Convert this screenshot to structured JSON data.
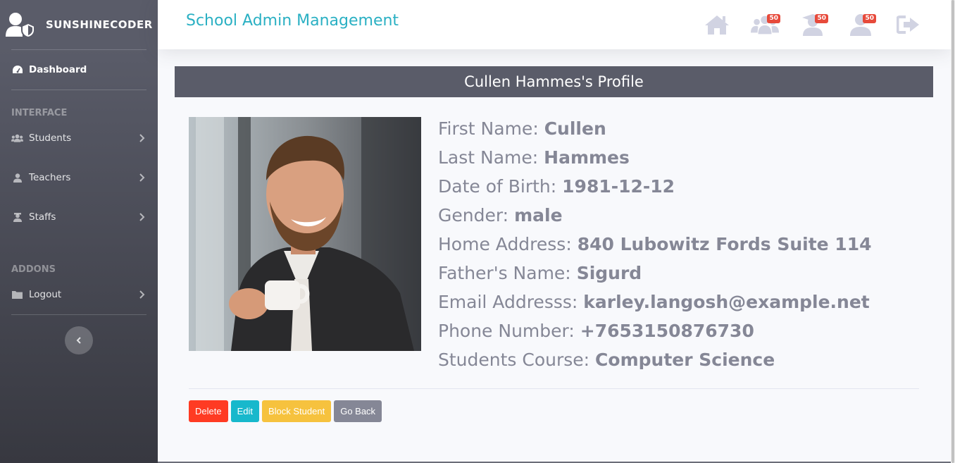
{
  "brand": {
    "name": "SUNSHINECODER",
    "icon": "user-shield-icon"
  },
  "sidebar": {
    "dashboard": {
      "label": "Dashboard",
      "icon": "tachometer-icon"
    },
    "interface_heading": "INTERFACE",
    "items": [
      {
        "label": "Students",
        "icon": "users-icon"
      },
      {
        "label": "Teachers",
        "icon": "user-icon"
      },
      {
        "label": "Staffs",
        "icon": "user-tie-icon"
      }
    ],
    "addons_heading": "ADDONS",
    "logout": {
      "label": "Logout",
      "icon": "folder-icon"
    },
    "toggle_icon": "chevron-left-icon"
  },
  "topbar": {
    "title": "School Admin Management",
    "icons": [
      {
        "name": "home-icon"
      },
      {
        "name": "users-icon",
        "badge": "50"
      },
      {
        "name": "user-graduate-icon",
        "badge": "50"
      },
      {
        "name": "user-icon",
        "badge": "50"
      },
      {
        "name": "sign-out-icon"
      }
    ]
  },
  "profile": {
    "header": "Cullen Hammes's Profile",
    "fields": [
      {
        "label": "First Name:",
        "value": "Cullen"
      },
      {
        "label": "Last Name:",
        "value": "Hammes"
      },
      {
        "label": "Date of Birth:",
        "value": "1981-12-12"
      },
      {
        "label": "Gender:",
        "value": "male"
      },
      {
        "label": "Home Address:",
        "value": "840 Lubowitz Fords Suite 114"
      },
      {
        "label": "Father's Name:",
        "value": "Sigurd"
      },
      {
        "label": "Email Addresss:",
        "value": "karley.langosh@example.net"
      },
      {
        "label": "Phone Number:",
        "value": "+7653150876730"
      },
      {
        "label": "Students Course:",
        "value": "Computer Science"
      }
    ]
  },
  "actions": {
    "delete": "Delete",
    "edit": "Edit",
    "block": "Block Student",
    "back": "Go Back"
  },
  "colors": {
    "accent": "#2ab0c3",
    "sidebar": "#5a5c69",
    "danger": "#ff3b23",
    "info": "#17b8cc",
    "warning": "#f6c23e",
    "secondary": "#858796"
  }
}
